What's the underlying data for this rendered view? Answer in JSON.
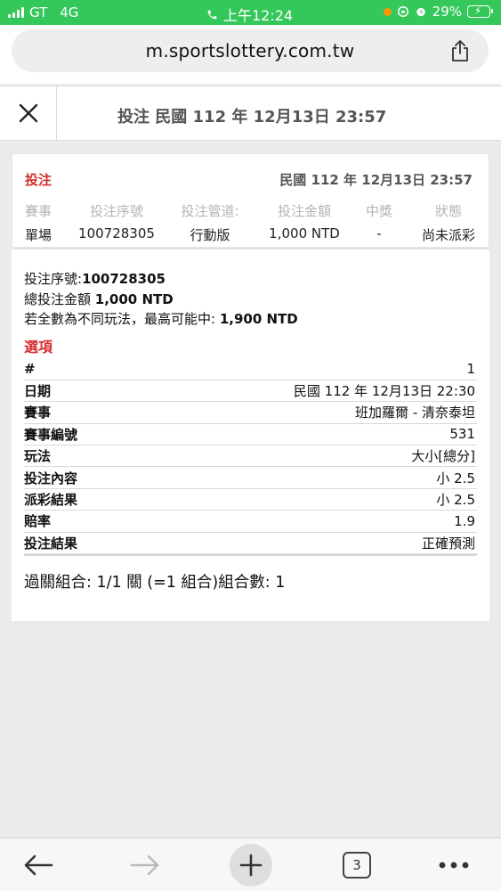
{
  "status_bar": {
    "carrier": "GT",
    "network": "4G",
    "time": "上午12:24",
    "battery": "29%"
  },
  "browser": {
    "url": "m.sportslottery.com.tw",
    "tab_count": "3"
  },
  "header": {
    "title": "投注 民國 112 年 12月13日 23:57"
  },
  "bet": {
    "label": "投注",
    "date": "民國 112 年 12月13日 23:57",
    "columns": [
      {
        "header": "賽事",
        "value": "單場"
      },
      {
        "header": "投注序號",
        "value": "100728305"
      },
      {
        "header": "投注管道:",
        "value": "行動版"
      },
      {
        "header": "投注金額",
        "value": "1,000 NTD"
      },
      {
        "header": "中獎",
        "value": "-"
      },
      {
        "header": "狀態",
        "value": "尚未派彩"
      }
    ],
    "serial_label": "投注序號:",
    "serial_value": "100728305",
    "total_label": "總投注金額 ",
    "total_value": "1,000 NTD",
    "max_label": "若全數為不同玩法，最高可能中: ",
    "max_value": "1,900 NTD"
  },
  "options": {
    "title": "選項",
    "rows": [
      {
        "key": "#",
        "value": "1"
      },
      {
        "key": "日期",
        "value": "民國 112 年 12月13日 22:30"
      },
      {
        "key": "賽事",
        "value": "班加羅爾 - 清奈泰坦"
      },
      {
        "key": "賽事編號",
        "value": "531"
      },
      {
        "key": "玩法",
        "value": "大小[總分]"
      },
      {
        "key": "投注內容",
        "value": "小 2.5"
      },
      {
        "key": "派彩結果",
        "value": "小 2.5"
      },
      {
        "key": "賠率",
        "value": "1.9"
      },
      {
        "key": "投注結果",
        "value": "正確預測"
      }
    ]
  },
  "parlay": "過關組合: 1/1 關 (=1 組合)組合數: 1",
  "colors": {
    "status_green": "#34c759",
    "accent_red": "#d32f2f",
    "muted_header": "#b4b4b4"
  }
}
